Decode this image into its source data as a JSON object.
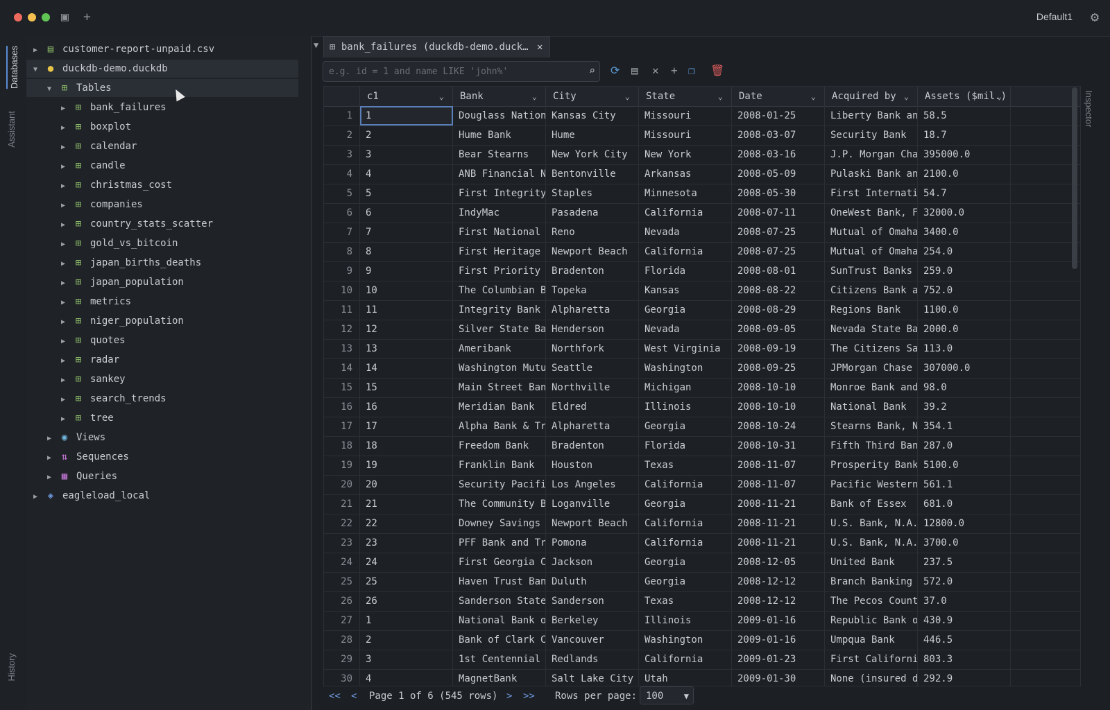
{
  "window": {
    "profile": "Default1"
  },
  "vertical_tabs": {
    "databases": "Databases",
    "assistant": "Assistant",
    "history": "History",
    "inspector": "Inspector"
  },
  "tree": {
    "items": [
      {
        "label": "customer-report-unpaid.csv",
        "level": 0,
        "expanded": false,
        "icon": "csv-file-icon"
      },
      {
        "label": "duckdb-demo.duckdb",
        "level": 0,
        "expanded": true,
        "icon": "duckdb-icon"
      },
      {
        "label": "Tables",
        "level": 1,
        "expanded": true,
        "icon": "table-icon"
      },
      {
        "label": "bank_failures",
        "level": 2,
        "icon": "table-icon"
      },
      {
        "label": "boxplot",
        "level": 2,
        "icon": "table-icon"
      },
      {
        "label": "calendar",
        "level": 2,
        "icon": "table-icon"
      },
      {
        "label": "candle",
        "level": 2,
        "icon": "table-icon"
      },
      {
        "label": "christmas_cost",
        "level": 2,
        "icon": "table-icon"
      },
      {
        "label": "companies",
        "level": 2,
        "icon": "table-icon"
      },
      {
        "label": "country_stats_scatter",
        "level": 2,
        "icon": "table-icon"
      },
      {
        "label": "gold_vs_bitcoin",
        "level": 2,
        "icon": "table-icon"
      },
      {
        "label": "japan_births_deaths",
        "level": 2,
        "icon": "table-icon"
      },
      {
        "label": "japan_population",
        "level": 2,
        "icon": "table-icon"
      },
      {
        "label": "metrics",
        "level": 2,
        "icon": "table-icon"
      },
      {
        "label": "niger_population",
        "level": 2,
        "icon": "table-icon"
      },
      {
        "label": "quotes",
        "level": 2,
        "icon": "table-icon"
      },
      {
        "label": "radar",
        "level": 2,
        "icon": "table-icon"
      },
      {
        "label": "sankey",
        "level": 2,
        "icon": "table-icon"
      },
      {
        "label": "search_trends",
        "level": 2,
        "icon": "table-icon"
      },
      {
        "label": "tree",
        "level": 2,
        "icon": "table-icon"
      },
      {
        "label": "Views",
        "level": 1,
        "icon": "eye-icon"
      },
      {
        "label": "Sequences",
        "level": 1,
        "icon": "sequence-icon"
      },
      {
        "label": "Queries",
        "level": 1,
        "icon": "query-icon"
      },
      {
        "label": "eagleload_local",
        "level": 0,
        "expanded": false,
        "icon": "postgres-icon"
      }
    ]
  },
  "tab": {
    "label": "bank_failures (duckdb-demo.duck…"
  },
  "search": {
    "placeholder": "e.g. id = 1 and name LIKE 'john%'"
  },
  "columns": [
    "c1",
    "Bank",
    "City",
    "State",
    "Date",
    "Acquired by",
    "Assets ($mil.)"
  ],
  "rows": [
    [
      "1",
      "1",
      "Douglass National Bank",
      "Kansas City",
      "Missouri",
      "2008-01-25",
      "Liberty Bank and Trust",
      "58.5"
    ],
    [
      "2",
      "2",
      "Hume Bank",
      "Hume",
      "Missouri",
      "2008-03-07",
      "Security Bank",
      "18.7"
    ],
    [
      "3",
      "3",
      "Bear Stearns",
      "New York City",
      "New York",
      "2008-03-16",
      "J.P. Morgan Chase",
      "395000.0"
    ],
    [
      "4",
      "4",
      "ANB Financial N.A.",
      "Bentonville",
      "Arkansas",
      "2008-05-09",
      "Pulaski Bank and Trust",
      "2100.0"
    ],
    [
      "5",
      "5",
      "First Integrity Bank",
      "Staples",
      "Minnesota",
      "2008-05-30",
      "First International Bank",
      "54.7"
    ],
    [
      "6",
      "6",
      "IndyMac",
      "Pasadena",
      "California",
      "2008-07-11",
      "OneWest Bank, FSB",
      "32000.0"
    ],
    [
      "7",
      "7",
      "First National Bank",
      "Reno",
      "Nevada",
      "2008-07-25",
      "Mutual of Omaha",
      "3400.0"
    ],
    [
      "8",
      "8",
      "First Heritage Bank",
      "Newport Beach",
      "California",
      "2008-07-25",
      "Mutual of Omaha",
      "254.0"
    ],
    [
      "9",
      "9",
      "First Priority Bank",
      "Bradenton",
      "Florida",
      "2008-08-01",
      "SunTrust Banks",
      "259.0"
    ],
    [
      "10",
      "10",
      "The Columbian Bank",
      "Topeka",
      "Kansas",
      "2008-08-22",
      "Citizens Bank and Trust",
      "752.0"
    ],
    [
      "11",
      "11",
      "Integrity Bank",
      "Alpharetta",
      "Georgia",
      "2008-08-29",
      "Regions Bank",
      "1100.0"
    ],
    [
      "12",
      "12",
      "Silver State Bank",
      "Henderson",
      "Nevada",
      "2008-09-05",
      "Nevada State Bank",
      "2000.0"
    ],
    [
      "13",
      "13",
      "Ameribank",
      "Northfork",
      "West Virginia",
      "2008-09-19",
      "The Citizens Savings",
      "113.0"
    ],
    [
      "14",
      "14",
      "Washington Mutual",
      "Seattle",
      "Washington",
      "2008-09-25",
      "JPMorgan Chase & Co",
      "307000.0"
    ],
    [
      "15",
      "15",
      "Main Street Bank",
      "Northville",
      "Michigan",
      "2008-10-10",
      "Monroe Bank and Trust",
      "98.0"
    ],
    [
      "16",
      "16",
      "Meridian Bank",
      "Eldred",
      "Illinois",
      "2008-10-10",
      "National Bank",
      "39.2"
    ],
    [
      "17",
      "17",
      "Alpha Bank & Trust",
      "Alpharetta",
      "Georgia",
      "2008-10-24",
      "Stearns Bank, N.A.",
      "354.1"
    ],
    [
      "18",
      "18",
      "Freedom Bank",
      "Bradenton",
      "Florida",
      "2008-10-31",
      "Fifth Third Bank",
      "287.0"
    ],
    [
      "19",
      "19",
      "Franklin Bank",
      "Houston",
      "Texas",
      "2008-11-07",
      "Prosperity Bank",
      "5100.0"
    ],
    [
      "20",
      "20",
      "Security Pacific",
      "Los Angeles",
      "California",
      "2008-11-07",
      "Pacific Western",
      "561.1"
    ],
    [
      "21",
      "21",
      "The Community Bank",
      "Loganville",
      "Georgia",
      "2008-11-21",
      "Bank of Essex",
      "681.0"
    ],
    [
      "22",
      "22",
      "Downey Savings and Loan",
      "Newport Beach",
      "California",
      "2008-11-21",
      "U.S. Bank, N.A.",
      "12800.0"
    ],
    [
      "23",
      "23",
      "PFF Bank and Trust",
      "Pomona",
      "California",
      "2008-11-21",
      "U.S. Bank, N.A.",
      "3700.0"
    ],
    [
      "24",
      "24",
      "First Georgia Community",
      "Jackson",
      "Georgia",
      "2008-12-05",
      "United Bank",
      "237.5"
    ],
    [
      "25",
      "25",
      "Haven Trust Bank",
      "Duluth",
      "Georgia",
      "2008-12-12",
      "Branch Banking and Trust",
      "572.0"
    ],
    [
      "26",
      "26",
      "Sanderson State Bank",
      "Sanderson",
      "Texas",
      "2008-12-12",
      "The Pecos County",
      "37.0"
    ],
    [
      "27",
      "1",
      "National Bank of Commerce",
      "Berkeley",
      "Illinois",
      "2009-01-16",
      "Republic Bank of Chicago",
      "430.9"
    ],
    [
      "28",
      "2",
      "Bank of Clark County",
      "Vancouver",
      "Washington",
      "2009-01-16",
      "Umpqua Bank",
      "446.5"
    ],
    [
      "29",
      "3",
      "1st Centennial Bank",
      "Redlands",
      "California",
      "2009-01-23",
      "First California Bank",
      "803.3"
    ],
    [
      "30",
      "4",
      "MagnetBank",
      "Salt Lake City",
      "Utah",
      "2009-01-30",
      "None (insured deposits)",
      "292.9"
    ]
  ],
  "pager": {
    "first": "<<",
    "prev": "<",
    "info": "Page 1 of 6 (545 rows)",
    "next": ">",
    "last": ">>",
    "rows_per_page_label": "Rows per page:",
    "rows_per_page": "100"
  }
}
